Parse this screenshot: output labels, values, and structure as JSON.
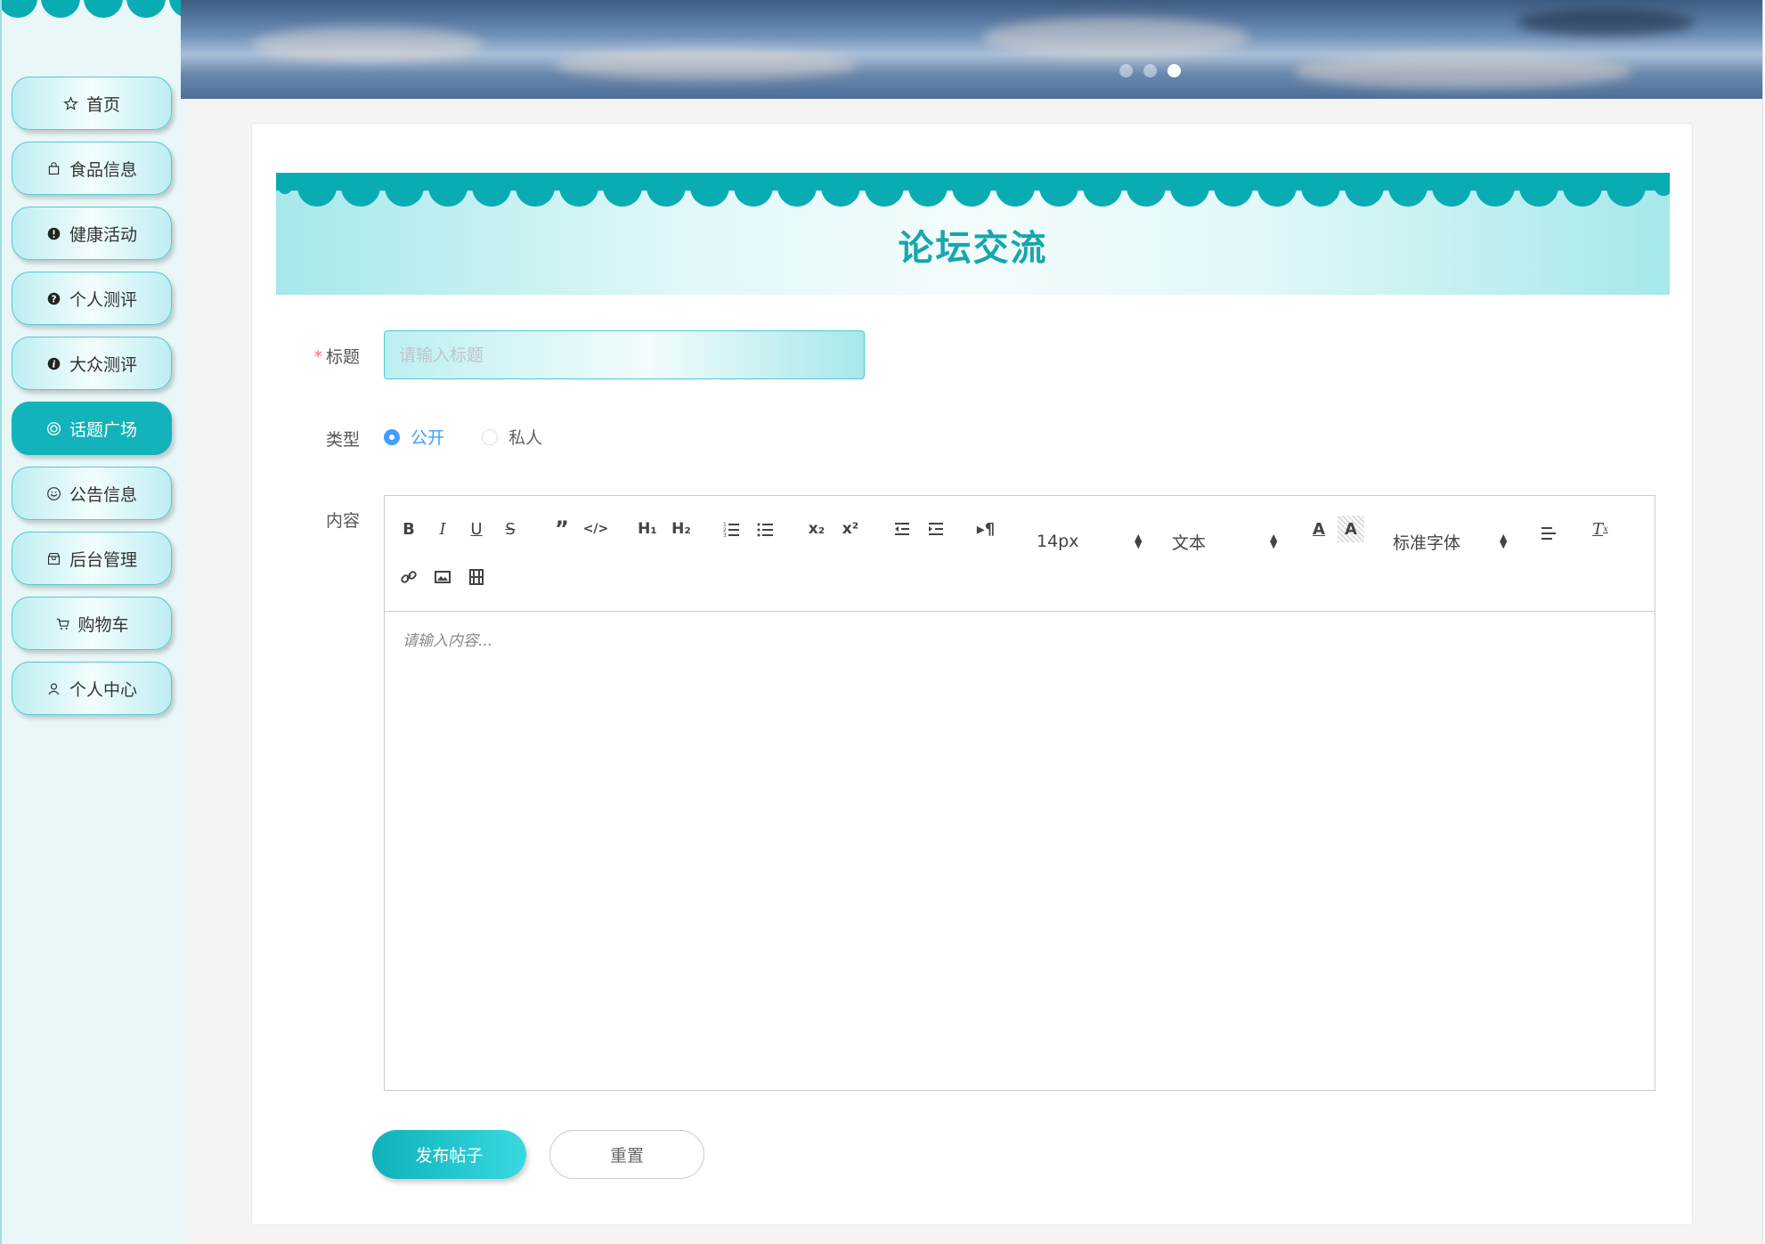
{
  "sidebar": {
    "items": [
      {
        "label": "首页",
        "icon": "star-icon",
        "active": false
      },
      {
        "label": "食品信息",
        "icon": "bag-icon",
        "active": false
      },
      {
        "label": "健康活动",
        "icon": "exclamation-circle-icon",
        "active": false
      },
      {
        "label": "个人测评",
        "icon": "question-circle-icon",
        "active": false
      },
      {
        "label": "大众测评",
        "icon": "info-circle-icon",
        "active": false
      },
      {
        "label": "话题广场",
        "icon": "target-icon",
        "active": true
      },
      {
        "label": "公告信息",
        "icon": "smile-icon",
        "active": false
      },
      {
        "label": "后台管理",
        "icon": "box-icon",
        "active": false
      },
      {
        "label": "购物车",
        "icon": "cart-icon",
        "active": false
      },
      {
        "label": "个人中心",
        "icon": "user-icon",
        "active": false
      }
    ]
  },
  "banner": {
    "dots": 3,
    "active_dot": 3
  },
  "page": {
    "title": "论坛交流"
  },
  "form": {
    "title_label": "标题",
    "title_required_mark": "*",
    "title_placeholder": "请输入标题",
    "type_label": "类型",
    "type_options": [
      {
        "label": "公开",
        "checked": true
      },
      {
        "label": "私人",
        "checked": false
      }
    ],
    "content_label": "内容",
    "content_placeholder": "请输入内容...",
    "toolbar": {
      "font_size": "14px",
      "header": "文本",
      "font_family": "标准字体"
    },
    "submit_label": "发布帖子",
    "reset_label": "重置"
  },
  "colors": {
    "accent": "#12b3ba",
    "radio_blue": "#409eff",
    "title_color": "#16a7ad"
  }
}
